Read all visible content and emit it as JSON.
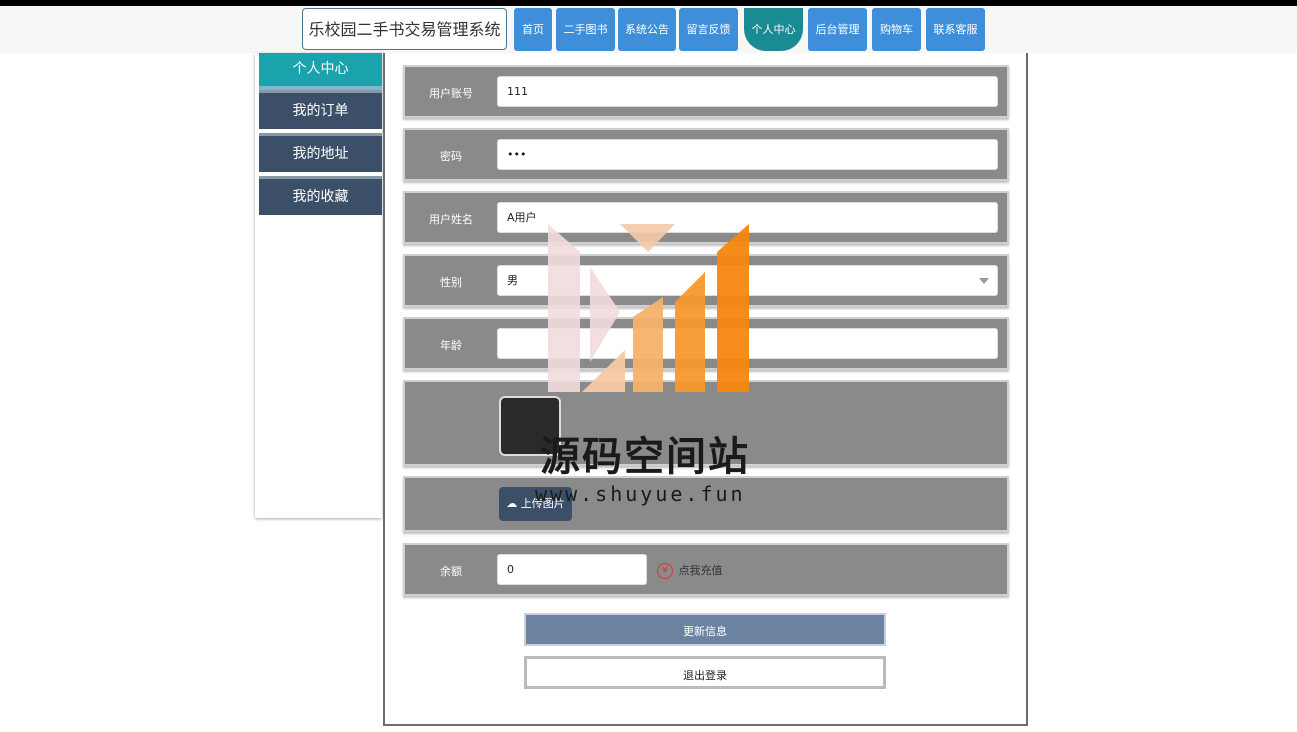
{
  "header": {
    "site_title": "乐校园二手书交易管理系统",
    "nav": [
      {
        "label": "首页"
      },
      {
        "label": "二手图书"
      },
      {
        "label": "系统公告"
      },
      {
        "label": "留言反馈"
      },
      {
        "label": "个人中心",
        "active": true
      },
      {
        "label": "后台管理"
      },
      {
        "label": "购物车"
      },
      {
        "label": "联系客服"
      }
    ]
  },
  "sidebar": {
    "items": [
      {
        "label": "个人中心",
        "active": true
      },
      {
        "label": "我的订单"
      },
      {
        "label": "我的地址"
      },
      {
        "label": "我的收藏"
      }
    ]
  },
  "form": {
    "account": {
      "label": "用户账号",
      "value": "111"
    },
    "password": {
      "label": "密码",
      "value": "•••"
    },
    "name": {
      "label": "用户姓名",
      "value": "A用户"
    },
    "gender": {
      "label": "性别",
      "value": "男"
    },
    "age": {
      "label": "年龄",
      "value": ""
    },
    "upload_label": "上传图片",
    "balance": {
      "label": "余额",
      "value": "0",
      "recharge_label": "点我充值"
    }
  },
  "buttons": {
    "update": "更新信息",
    "logout": "退出登录"
  },
  "watermark": {
    "title": "源码空间站",
    "url": "www.shuyue.fun"
  },
  "colors": {
    "nav_blue": "#3f8ed9",
    "active_teal": "#1a8a93",
    "sidebar_dark": "#3b5068",
    "row_gray": "#8a8a8a"
  }
}
